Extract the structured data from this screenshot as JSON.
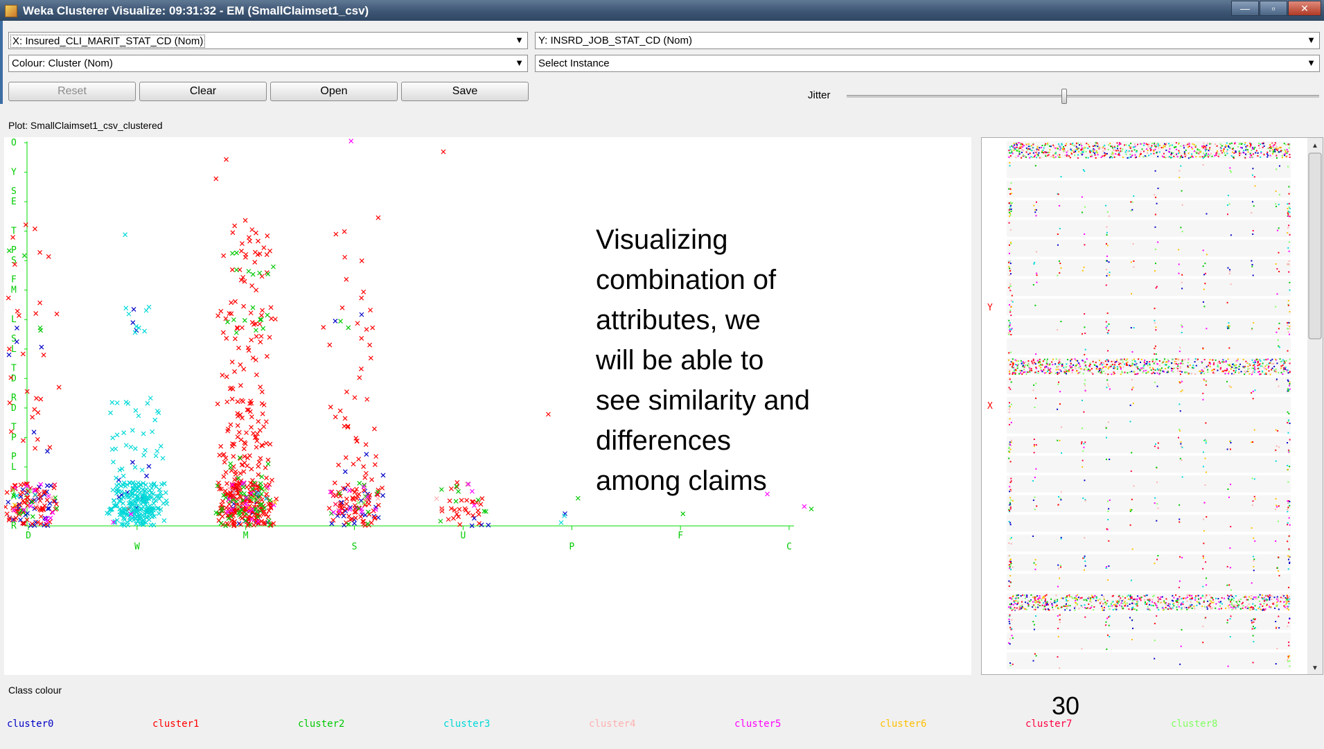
{
  "window": {
    "title": "Weka Clusterer Visualize: 09:31:32 - EM (SmallClaimset1_csv)",
    "minimize": "—",
    "maximize": "▫",
    "close": "✕"
  },
  "controls": {
    "x_axis": "X: Insured_CLI_MARIT_STAT_CD (Nom)",
    "y_axis": "Y: INSRD_JOB_STAT_CD (Nom)",
    "colour": "Colour: Cluster (Nom)",
    "select_instance": "Select Instance",
    "reset": "Reset",
    "clear": "Clear",
    "open": "Open",
    "save": "Save",
    "jitter": "Jitter",
    "jitter_value": 0.46
  },
  "plot": {
    "label": "Plot: SmallClaimset1_csv_clustered"
  },
  "chart_data": {
    "type": "scatter",
    "x_categories": [
      "D",
      "W",
      "M",
      "S",
      "U",
      "P",
      "F",
      "C"
    ],
    "y_categories": [
      "R",
      "A",
      "PL",
      "TP",
      "RD",
      "TD",
      "SL",
      "L",
      "FM",
      "PS",
      "T",
      "SE",
      "Y",
      "TO"
    ],
    "series": [
      {
        "name": "cluster0",
        "color": "#0000c8",
        "points": [
          [
            "D",
            "A",
            18
          ],
          [
            "D",
            "R",
            16
          ],
          [
            "D",
            "L",
            2
          ],
          [
            "D",
            "SL",
            3
          ],
          [
            "D",
            "TP",
            2
          ],
          [
            "W",
            "A",
            6
          ],
          [
            "W",
            "PL",
            4
          ],
          [
            "W",
            "L",
            3
          ],
          [
            "M",
            "A",
            9
          ],
          [
            "M",
            "R",
            9
          ],
          [
            "S",
            "A",
            11
          ],
          [
            "S",
            "R",
            11
          ],
          [
            "S",
            "L",
            2
          ],
          [
            "S",
            "PL",
            3
          ],
          [
            "U",
            "R",
            4
          ],
          [
            "P",
            "R",
            1
          ]
        ]
      },
      {
        "name": "cluster1",
        "color": "#ff0000",
        "points": [
          [
            "D",
            "A",
            40
          ],
          [
            "D",
            "R",
            30
          ],
          [
            "D",
            "RD",
            6
          ],
          [
            "D",
            "TP",
            5
          ],
          [
            "D",
            "L",
            4
          ],
          [
            "D",
            "T",
            3
          ],
          [
            "D",
            "SL",
            3
          ],
          [
            "D",
            "TD",
            3
          ],
          [
            "D",
            "FM",
            2
          ],
          [
            "D",
            "PS",
            3
          ],
          [
            "W",
            "A",
            1
          ],
          [
            "M",
            "A",
            120
          ],
          [
            "M",
            "R",
            95
          ],
          [
            "M",
            "PL",
            35
          ],
          [
            "M",
            "TP",
            28
          ],
          [
            "M",
            "RD",
            22
          ],
          [
            "M",
            "TD",
            12
          ],
          [
            "M",
            "SL",
            14
          ],
          [
            "M",
            "L",
            20
          ],
          [
            "M",
            "FM",
            8
          ],
          [
            "M",
            "PS",
            14
          ],
          [
            "M",
            "T",
            10
          ],
          [
            "M",
            "Y",
            2
          ],
          [
            "S",
            "A",
            38
          ],
          [
            "S",
            "R",
            28
          ],
          [
            "S",
            "PL",
            10
          ],
          [
            "S",
            "TP",
            8
          ],
          [
            "S",
            "RD",
            6
          ],
          [
            "S",
            "TD",
            3
          ],
          [
            "S",
            "SL",
            4
          ],
          [
            "S",
            "L",
            6
          ],
          [
            "S",
            "FM",
            3
          ],
          [
            "S",
            "PS",
            2
          ],
          [
            "S",
            "T",
            3
          ],
          [
            "U",
            "A",
            14
          ],
          [
            "U",
            "R",
            14
          ],
          [
            "U",
            "TO",
            1
          ],
          [
            "P",
            "RD",
            1
          ]
        ]
      },
      {
        "name": "cluster2",
        "color": "#00c800",
        "points": [
          [
            "D",
            "A",
            6
          ],
          [
            "D",
            "R",
            4
          ],
          [
            "D",
            "L",
            2
          ],
          [
            "D",
            "PS",
            2
          ],
          [
            "M",
            "A",
            30
          ],
          [
            "M",
            "R",
            22
          ],
          [
            "M",
            "PL",
            6
          ],
          [
            "M",
            "L",
            10
          ],
          [
            "M",
            "PS",
            8
          ],
          [
            "S",
            "A",
            8
          ],
          [
            "S",
            "R",
            4
          ],
          [
            "S",
            "L",
            2
          ],
          [
            "U",
            "A",
            6
          ],
          [
            "U",
            "R",
            3
          ],
          [
            "P",
            "A",
            1
          ],
          [
            "F",
            "R",
            1
          ],
          [
            "C",
            "R",
            1
          ]
        ]
      },
      {
        "name": "cluster3",
        "color": "#00d8d8",
        "points": [
          [
            "W",
            "A",
            140
          ],
          [
            "W",
            "R",
            95
          ],
          [
            "W",
            "PL",
            10
          ],
          [
            "W",
            "TP",
            14
          ],
          [
            "W",
            "RD",
            12
          ],
          [
            "W",
            "L",
            8
          ],
          [
            "W",
            "T",
            1
          ],
          [
            "D",
            "A",
            2
          ],
          [
            "M",
            "A",
            2
          ],
          [
            "P",
            "R",
            2
          ]
        ]
      },
      {
        "name": "cluster4",
        "color": "#ffb0b0",
        "points": [
          [
            "D",
            "A",
            3
          ],
          [
            "M",
            "A",
            4
          ],
          [
            "S",
            "A",
            3
          ],
          [
            "U",
            "A",
            3
          ]
        ]
      },
      {
        "name": "cluster5",
        "color": "#ff00ff",
        "points": [
          [
            "D",
            "A",
            8
          ],
          [
            "D",
            "R",
            5
          ],
          [
            "M",
            "A",
            10
          ],
          [
            "M",
            "R",
            6
          ],
          [
            "S",
            "A",
            6
          ],
          [
            "S",
            "R",
            4
          ],
          [
            "S",
            "TO",
            1
          ],
          [
            "U",
            "A",
            3
          ],
          [
            "C",
            "A",
            2
          ],
          [
            "W",
            "R",
            2
          ]
        ]
      },
      {
        "name": "cluster6",
        "color": "#ffc000",
        "points": [
          [
            "D",
            "A",
            1
          ],
          [
            "M",
            "A",
            2
          ]
        ]
      },
      {
        "name": "cluster7",
        "color": "#ff0040",
        "points": [
          [
            "D",
            "A",
            4
          ],
          [
            "M",
            "A",
            5
          ],
          [
            "S",
            "A",
            3
          ]
        ]
      },
      {
        "name": "cluster8",
        "color": "#80ff60",
        "points": [
          [
            "D",
            "A",
            2
          ],
          [
            "M",
            "A",
            3
          ],
          [
            "S",
            "A",
            2
          ]
        ]
      }
    ]
  },
  "matrix": {
    "y_marker": "Y",
    "x_marker": "X",
    "rows": 27
  },
  "annotation": {
    "lines": [
      "Visualizing",
      "combination of",
      "attributes, we",
      "will be able to",
      "see similarity and",
      "differences",
      "among claims"
    ]
  },
  "legend": {
    "title": "Class colour",
    "items": [
      {
        "label": "cluster0",
        "color": "#0000c8"
      },
      {
        "label": "cluster1",
        "color": "#ff0000"
      },
      {
        "label": "cluster2",
        "color": "#00c800"
      },
      {
        "label": "cluster3",
        "color": "#00d8d8"
      },
      {
        "label": "cluster4",
        "color": "#ffb0b0"
      },
      {
        "label": "cluster5",
        "color": "#ff00ff"
      },
      {
        "label": "cluster6",
        "color": "#ffc000"
      },
      {
        "label": "cluster7",
        "color": "#ff0040"
      },
      {
        "label": "cluster8",
        "color": "#80ff60"
      }
    ]
  },
  "slide_number": "30"
}
